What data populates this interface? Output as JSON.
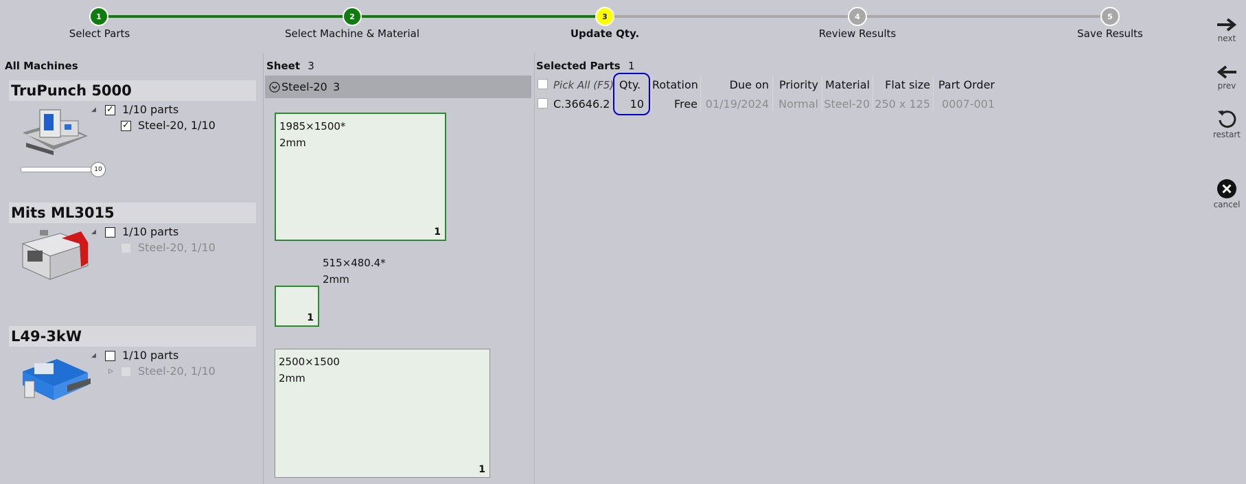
{
  "stepper": {
    "steps": [
      {
        "num": "1",
        "label": "Select Parts",
        "state": "done"
      },
      {
        "num": "2",
        "label": "Select Machine & Material",
        "state": "done"
      },
      {
        "num": "3",
        "label": "Update Qty.",
        "state": "current"
      },
      {
        "num": "4",
        "label": "Review Results",
        "state": "pending"
      },
      {
        "num": "5",
        "label": "Save Results",
        "state": "pending"
      }
    ],
    "colors": {
      "done": "#107c10",
      "current": "#ffff00",
      "pending": "#a8a8a8"
    }
  },
  "nav": {
    "next": {
      "label": "next",
      "icon": "arrow-right-icon"
    },
    "prev": {
      "label": "prev",
      "icon": "arrow-left-icon"
    },
    "restart": {
      "label": "restart",
      "icon": "restart-icon"
    },
    "cancel": {
      "label": "cancel",
      "icon": "close-circle-icon"
    }
  },
  "machines_panel": {
    "title": "All Machines",
    "machines": [
      {
        "name": "TruPunch 5000",
        "parts_label": "1/10 parts",
        "parts_checked": true,
        "material_label": "Steel-20, 1/10",
        "material_checked": true,
        "slider_value": "10"
      },
      {
        "name": "Mits ML3015",
        "parts_label": "1/10 parts",
        "parts_checked": false,
        "material_label": "Steel-20, 1/10",
        "material_checked": false
      },
      {
        "name": "L49-3kW",
        "parts_label": "1/10 parts",
        "parts_checked": false,
        "material_label": "Steel-20, 1/10",
        "material_checked": false
      }
    ]
  },
  "sheets_panel": {
    "title": "Sheet",
    "count": "3",
    "group": {
      "label": "Steel-20",
      "count": "3"
    },
    "sheets": [
      {
        "size": "1985×1500*",
        "thickness": "2mm",
        "count": "1"
      },
      {
        "size": "515×480.4*",
        "thickness": "2mm",
        "count": "1"
      },
      {
        "size": "2500×1500",
        "thickness": "2mm",
        "count": "1"
      }
    ]
  },
  "parts_panel": {
    "title": "Selected Parts",
    "count": "1",
    "columns": {
      "pick_all": "Pick All (F5)",
      "qty": "Qty.",
      "rotation": "Rotation",
      "due_on": "Due on",
      "priority": "Priority",
      "material": "Material",
      "flat_size": "Flat size",
      "part_order": "Part Order"
    },
    "rows": [
      {
        "part": "C.36646.2",
        "qty": "10",
        "rotation": "Free",
        "due_on": "01/19/2024",
        "priority": "Normal",
        "material": "Steel-20",
        "flat_size": "250 x 125",
        "part_order": "0007-001"
      }
    ],
    "highlight_color": "#0000cc"
  }
}
